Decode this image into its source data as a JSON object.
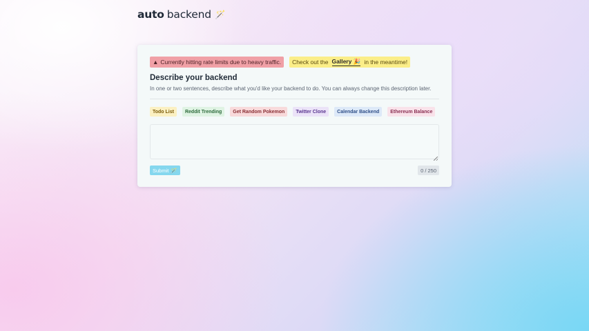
{
  "logo": {
    "bold": "auto",
    "rest": "backend",
    "icon": "🪄"
  },
  "alerts": {
    "rate_limit": {
      "icon": "▲",
      "text": "Currently hitting rate limits due to heavy traffic."
    },
    "gallery": {
      "prefix": "Check out the",
      "link": "Gallery",
      "emoji": "🎉",
      "suffix": "in the meantime!"
    }
  },
  "form": {
    "title": "Describe your backend",
    "subtitle": "In one or two sentences, describe what you'd like your backend to do. You can always change this description later.",
    "examples": [
      "Todo List",
      "Reddit Trending",
      "Get Random Pokemon",
      "Twitter Clone",
      "Calendar Backend",
      "Ethereum Balance"
    ],
    "description_value": "",
    "submit_label": "Submit",
    "submit_icon": "🪄",
    "counter": "0 / 250"
  }
}
